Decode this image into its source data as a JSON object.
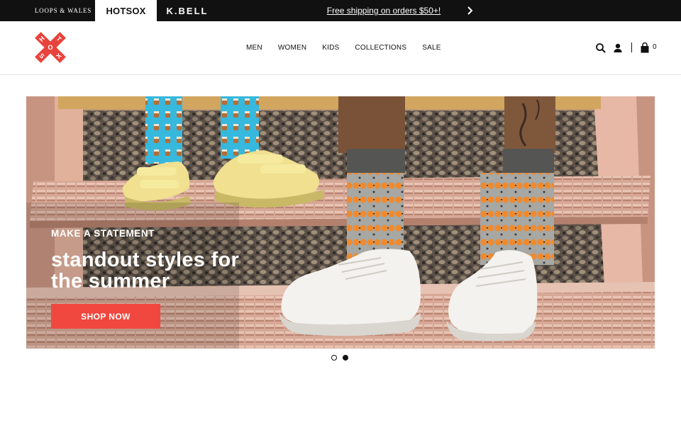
{
  "topbar": {
    "brands": [
      {
        "label": "LOOPS & WALES",
        "active": false
      },
      {
        "label": "HOTSOX",
        "active": true
      },
      {
        "label": "K.BELL",
        "active": false
      }
    ],
    "promo": "Free shipping on orders $50+!",
    "promo_next_icon": "chevron-right-icon"
  },
  "header": {
    "logo_letters": [
      "H",
      "O",
      "T",
      "S",
      "O",
      "X"
    ],
    "nav": [
      "MEN",
      "WOMEN",
      "KIDS",
      "COLLECTIONS",
      "SALE"
    ],
    "icons": [
      "search-icon",
      "account-icon",
      "shopping-bag-icon"
    ],
    "cart_count": "0"
  },
  "hero": {
    "kicker": "MAKE A STATEMENT",
    "headline": "standout styles for the summer",
    "cta": "SHOP NOW",
    "cta_color": "#f0483e"
  },
  "carousel": {
    "slides": 2,
    "active_slide": 2
  },
  "colors": {
    "topbar": "#111111",
    "brand_red": "#e8423c"
  }
}
